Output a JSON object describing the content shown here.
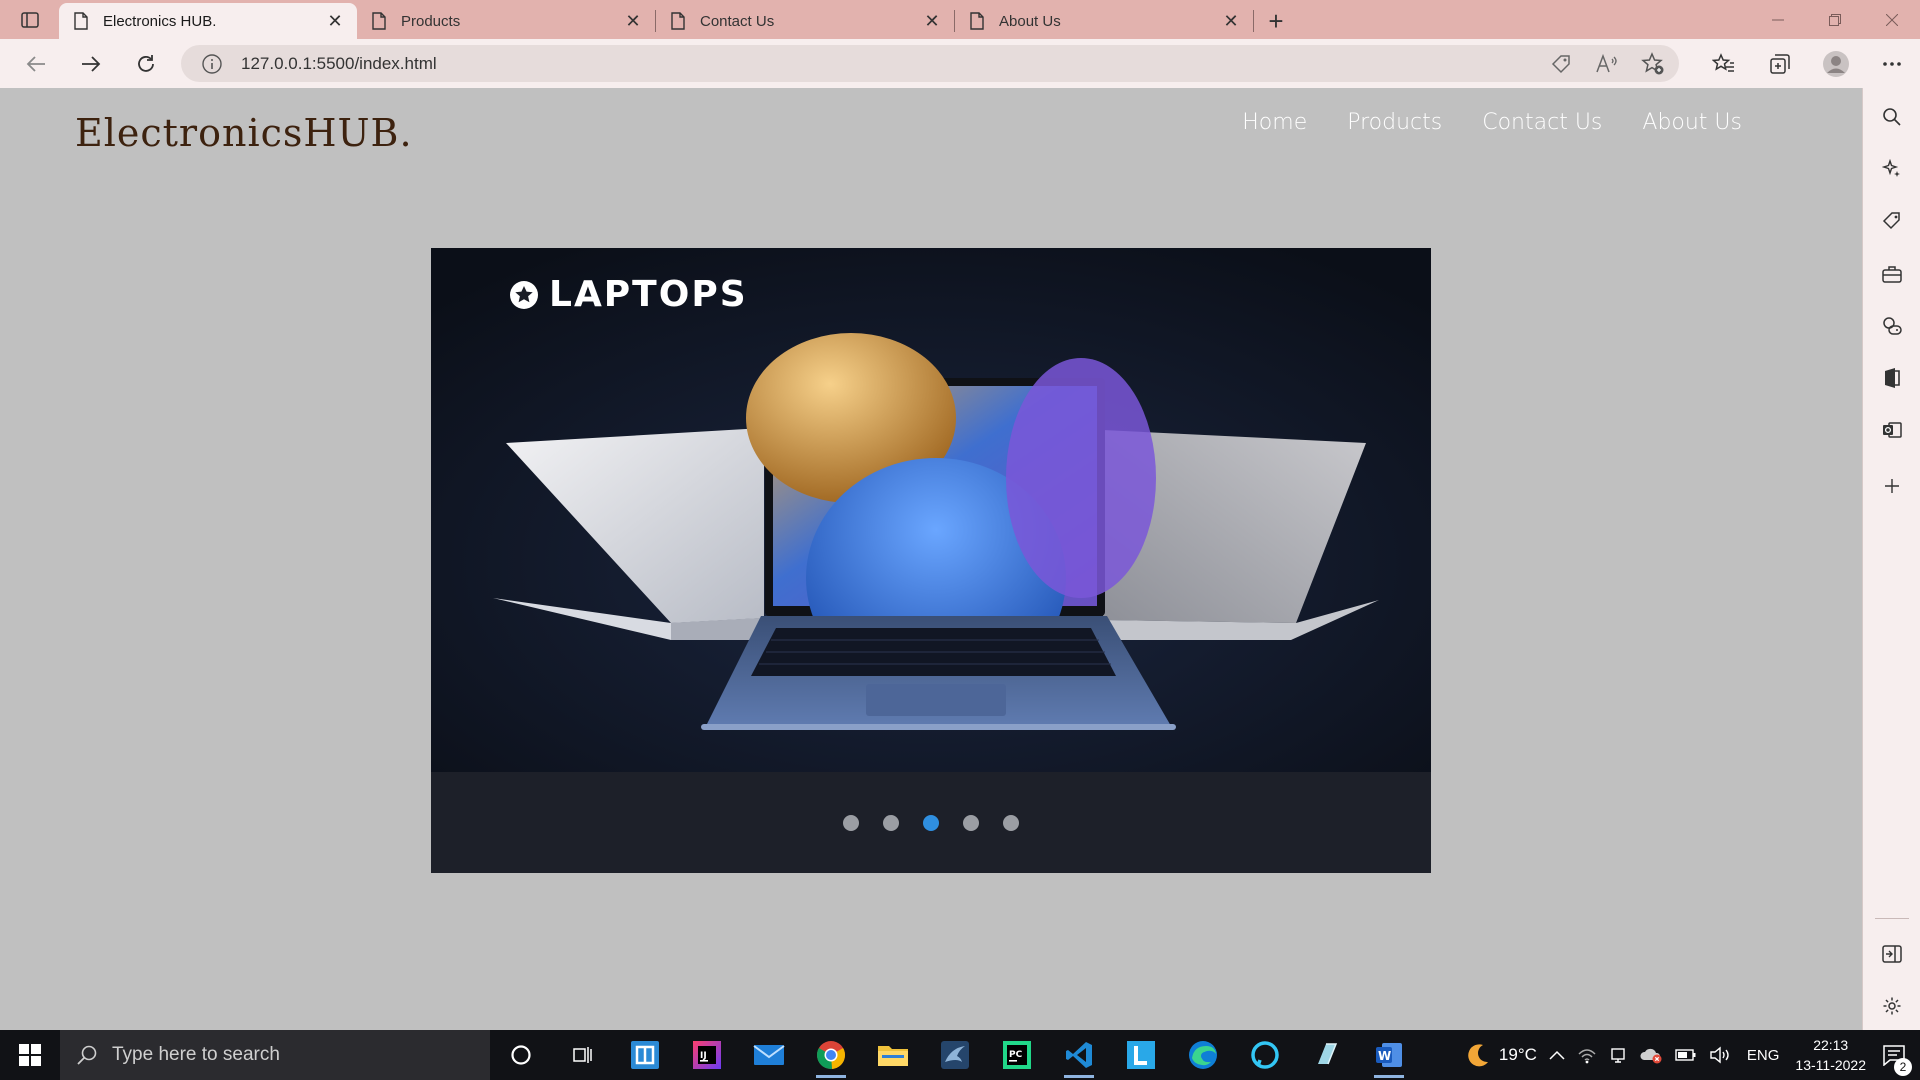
{
  "browser": {
    "tabs": [
      {
        "title": "Electronics HUB.",
        "active": true
      },
      {
        "title": "Products",
        "active": false
      },
      {
        "title": "Contact Us",
        "active": false
      },
      {
        "title": "About Us",
        "active": false
      }
    ],
    "url": "127.0.0.1:5500/index.html"
  },
  "site": {
    "logo": "ElectronicsHUB.",
    "nav": [
      "Home",
      "Products",
      "Contact Us",
      "About Us"
    ],
    "carousel": {
      "slide_title": "LAPTOPS",
      "slide_count": 5,
      "active_index": 2
    }
  },
  "taskbar": {
    "search_placeholder": "Type here to search",
    "weather": "19°C",
    "language": "ENG",
    "time": "22:13",
    "date": "13-11-2022",
    "notifications": "2"
  },
  "colors": {
    "tabbar": "#e2b2ae",
    "toolbar": "#f7eeee",
    "page_bg": "#c0c0c0",
    "logo": "#3d220f",
    "carousel_bg": "#1d2029",
    "dot_active": "#2f8fe0",
    "taskbar": "#111216"
  }
}
